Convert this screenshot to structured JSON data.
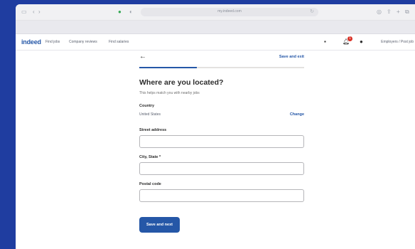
{
  "browser": {
    "url": "my.indeed.com"
  },
  "site_nav": {
    "logo": "indeed",
    "links": [
      "Find jobs",
      "Company reviews",
      "Find salaries"
    ],
    "notification_count": "1",
    "employers_link": "Employers / Post job"
  },
  "form": {
    "back_icon": "arrow-left-icon",
    "save_exit_label": "Save and exit",
    "progress": 0.35,
    "title": "Where are you located?",
    "subtitle": "This helps match you with nearby jobs",
    "country": {
      "label": "Country",
      "value": "United States",
      "change_label": "Change"
    },
    "fields": [
      {
        "label": "Street address",
        "value": ""
      },
      {
        "label": "City, State *",
        "value": ""
      },
      {
        "label": "Postal code",
        "value": ""
      }
    ],
    "submit_label": "Save and next"
  },
  "colors": {
    "background": "#1f3da0",
    "brand": "#2557a7"
  }
}
